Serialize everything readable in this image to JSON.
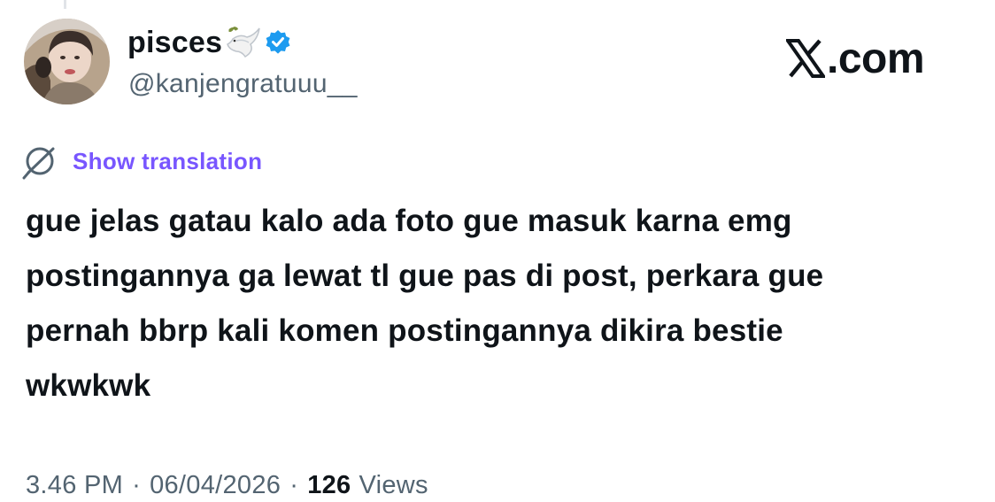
{
  "user": {
    "display_name": "pisces",
    "handle": "@kanjengratuuu__",
    "avatar_icon": "profile-photo",
    "name_emoji": "dove-with-olive-branch-icon",
    "verified_color": "#1d9bf0"
  },
  "brand": {
    "logo_text": ".com",
    "logo_icon": "x-logo-icon"
  },
  "translation": {
    "label": "Show translation",
    "icon": "globe-slash-icon",
    "color": "#7856ff"
  },
  "tweet": {
    "lines": [
      "gue jelas gatau kalo ada foto gue masuk karna emg",
      "postingannya ga lewat tl gue pas di post, perkara gue",
      "pernah bbrp kali komen postingannya dikira bestie",
      "wkwkwk"
    ]
  },
  "meta": {
    "time": "3.46 PM",
    "separator": "·",
    "date": "06/04/2026",
    "views_count": "126",
    "views_label": "Views"
  }
}
